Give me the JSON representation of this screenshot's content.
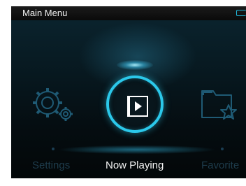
{
  "status_bar": {
    "title": "Main Menu",
    "battery_icon": "battery-icon"
  },
  "menu": {
    "items": [
      {
        "label": "Settings",
        "icon": "gear-icon",
        "state": "inactive"
      },
      {
        "label": "Now Playing",
        "icon": "play-icon",
        "state": "selected"
      },
      {
        "label": "Favorite",
        "icon": "folder-star-icon",
        "state": "inactive"
      }
    ]
  },
  "colors": {
    "accent": "#2bc8ea",
    "inactive_text": "#1e3c4c",
    "active_text": "#f4f4f4",
    "background": "#050d11"
  }
}
